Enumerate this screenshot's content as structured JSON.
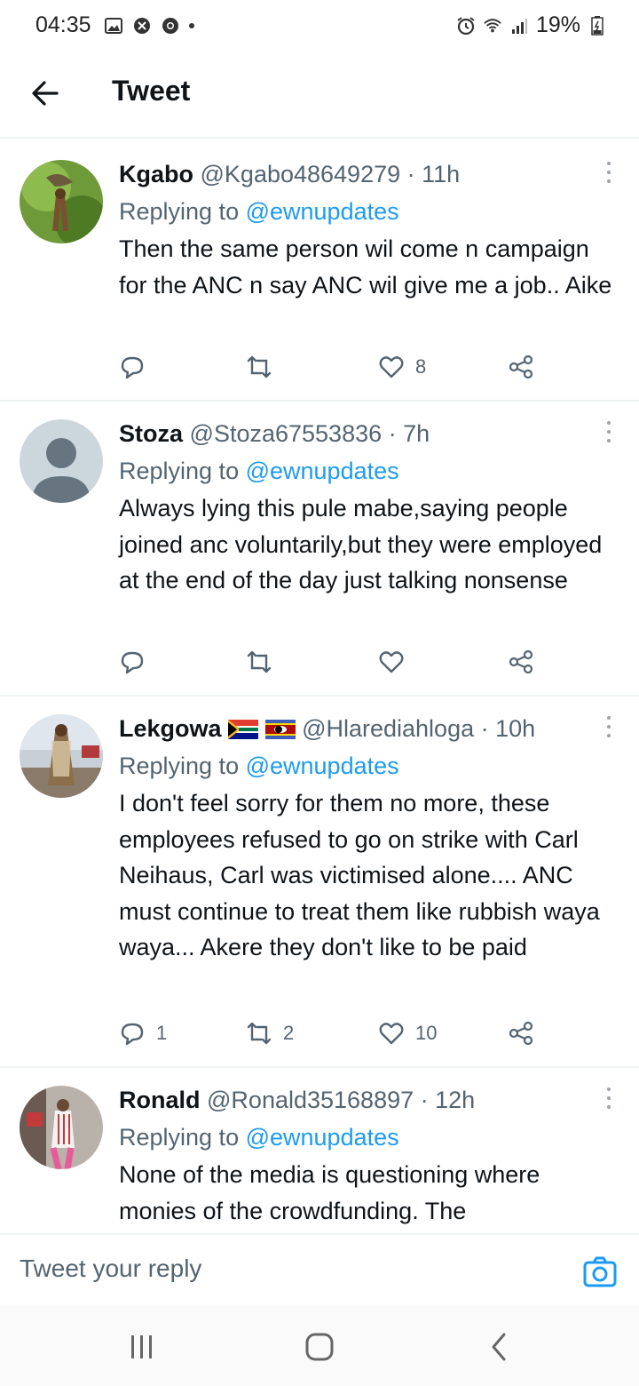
{
  "status_bar": {
    "time": "04:35",
    "battery": "19%",
    "left_icons": [
      "gallery-icon",
      "shield-icon",
      "chrome-icon",
      "dot"
    ],
    "right_icons": [
      "alarm-icon",
      "wifi-icon",
      "signal-icon",
      "battery-icon"
    ]
  },
  "header": {
    "title": "Tweet",
    "back_icon": "arrow-left-icon"
  },
  "tweets": [
    {
      "name": "Kgabo",
      "handle": "@Kgabo48649279",
      "time": "· 11h",
      "replying_prefix": "Replying to ",
      "replying_to": "@ewnupdates",
      "text": "Then the same person wil come n campaign for the ANC n say ANC wil give me a job.. Aike",
      "replies": "",
      "retweets": "",
      "likes": "8"
    },
    {
      "name": "Stoza",
      "handle": "@Stoza67553836",
      "time": "· 7h",
      "replying_prefix": "Replying to ",
      "replying_to": "@ewnupdates",
      "text": "Always lying this pule mabe,saying people joined anc voluntarily,but they were employed at the end of the day just talking nonsense",
      "replies": "",
      "retweets": "",
      "likes": ""
    },
    {
      "name": "Lekgowa",
      "handle": "@Hlarediahloga",
      "time": "· 10h",
      "replying_prefix": "Replying to ",
      "replying_to": "@ewnupdates",
      "text": "I don't feel sorry for them no more, these employees refused to go on strike with Carl Neihaus, Carl was victimised alone.... ANC must continue to treat them like rubbish waya waya... Akere they don't like to be paid",
      "replies": "1",
      "retweets": "2",
      "likes": "10"
    },
    {
      "name": "Ronald",
      "handle": "@Ronald35168897",
      "time": "· 12h",
      "replying_prefix": "Replying to ",
      "replying_to": "@ewnupdates",
      "text": "None of the media is questioning where monies of the crowdfunding. The"
    }
  ],
  "reply_box": {
    "placeholder": "Tweet your reply",
    "icon": "camera-icon"
  },
  "nav_bar": {
    "icons": [
      "recent-apps-icon",
      "home-icon",
      "back-icon"
    ]
  },
  "colors": {
    "accent": "#1d9bf0",
    "text": "#0f1419",
    "muted": "#536471",
    "divider": "#eff3f4"
  }
}
